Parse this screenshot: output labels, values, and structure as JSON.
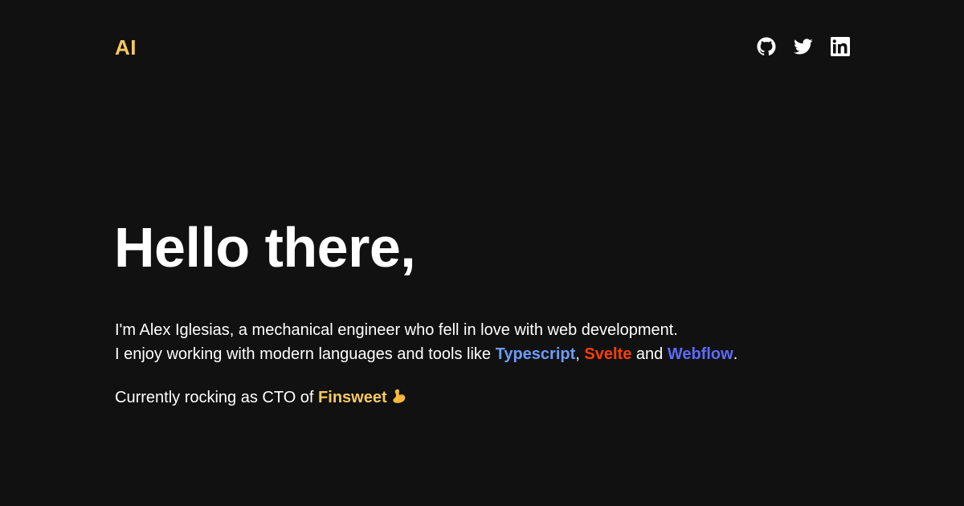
{
  "header": {
    "logo_text": "AI",
    "social": [
      {
        "name": "github",
        "icon": "github-icon"
      },
      {
        "name": "twitter",
        "icon": "twitter-icon"
      },
      {
        "name": "linkedin",
        "icon": "linkedin-icon"
      }
    ]
  },
  "hero": {
    "title": "Hello there,",
    "line1": "I'm Alex Iglesias, a mechanical engineer who fell in love with web development.",
    "line2_prefix": "I enjoy working with modern languages and tools like ",
    "tools": [
      {
        "label": "Typescript",
        "color": "#6b9cf7"
      },
      {
        "label": "Svelte",
        "color": "#ff3e00"
      },
      {
        "label": "Webflow",
        "color": "#5c6bf9"
      }
    ],
    "sep_comma": ", ",
    "sep_and": " and ",
    "line2_suffix": ".",
    "current_prefix": "Currently rocking as CTO of ",
    "company": "Finsweet",
    "company_color": "#f6c85f",
    "emoji_icon": "flexed-biceps-icon"
  },
  "colors": {
    "background": "#111111",
    "text": "#ffffff",
    "accent": "#f6c85f"
  }
}
